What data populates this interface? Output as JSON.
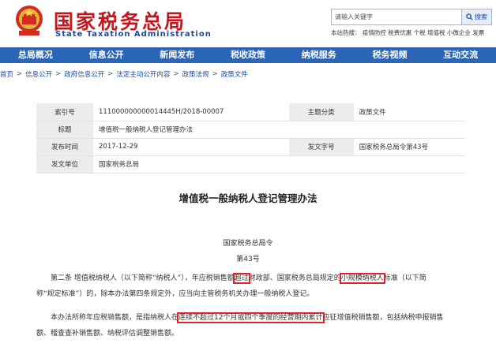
{
  "header": {
    "title_cn": "国家税务总局",
    "title_en": "State Taxation Administration",
    "search_placeholder": "请输入关键字",
    "search_button": "搜索",
    "hot_words": "本站热搜： 疫情防控 税费优惠 个税 增值税 小微企业 发票"
  },
  "nav": {
    "items": [
      {
        "label": "总局概况"
      },
      {
        "label": "信息公开"
      },
      {
        "label": "新闻发布"
      },
      {
        "label": "税收政策"
      },
      {
        "label": "纳税服务"
      },
      {
        "label": "税务视频"
      },
      {
        "label": "互动交流"
      }
    ]
  },
  "breadcrumb": [
    {
      "label": "首页"
    },
    {
      "label": "信息公开"
    },
    {
      "label": "政府信息公开"
    },
    {
      "label": "法定主动公开内容"
    },
    {
      "label": "政策法规"
    },
    {
      "label": "政策文件"
    }
  ],
  "meta": {
    "index_label": "索引号",
    "index_value": "111000000000014445H/2018-00007",
    "topic_label": "主题分类",
    "topic_value": "政策文件",
    "title_label": "标题",
    "title_value": "增值税一般纳税人登记管理办法",
    "date_label": "发布时间",
    "date_value": "2017-12-29",
    "docno_label": "发文字号",
    "docno_value": "国家税务总局令第43号",
    "unit_label": "发文单位",
    "unit_value": "国家税务总局"
  },
  "doc": {
    "title": "增值税一般纳税人登记管理办法",
    "issuer": "国家税务总局令",
    "number": "第43号",
    "p1_line1_a": "第二条 增值税纳税人（以下简称“纳税人”），年应税销售额",
    "p1_line1_hl1": "超过",
    "p1_line1_b": "财政部、国家税务总局规定的",
    "p1_line1_hl2": "小规模纳税人",
    "p1_line1_c": "标准（以下简",
    "p1_line2": "称“规定标准”）的，除本办法第四条规定外，应当向主管税务机关办理一般纳税人登记。",
    "p2_line1_a": "本办法所称年应税销售额，是指纳税人在",
    "p2_line1_hl": "连续不超过12个月或四个季度的经营期内累计",
    "p2_line1_b": "应征增值税销售额，包括纳税申报销售",
    "p2_line2": "额、稽查查补销售额、纳税评估调整销售额。"
  },
  "colors": {
    "brand_red": "#c4161c",
    "nav_blue": "#2a65b6",
    "highlight": "#e0242c"
  }
}
